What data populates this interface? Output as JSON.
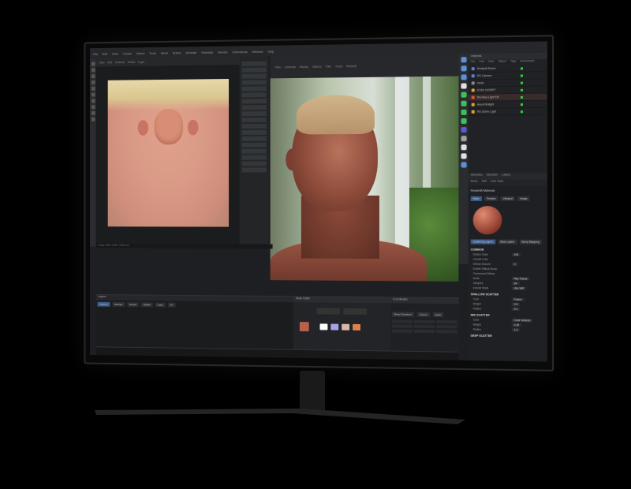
{
  "menubar": [
    "File",
    "Edit",
    "View",
    "Create",
    "Select",
    "Tools",
    "Mesh",
    "Spline",
    "Animate",
    "Simulate",
    "Render",
    "Extensions",
    "Window",
    "Help"
  ],
  "texture_panel": {
    "tabs": [
      "View",
      "Edit",
      "Channel",
      "Select",
      "Layer"
    ]
  },
  "viewport_toolbar": [
    "View",
    "Cameras",
    "Display",
    "Options",
    "Filter",
    "Panel",
    "Redshift"
  ],
  "objects": {
    "title": "Objects",
    "menu": [
      "File",
      "Edit",
      "View",
      "Object",
      "Tags",
      "Bookmarks"
    ],
    "rows": [
      {
        "label": "Redshift Dome",
        "color": "#5a7fd0",
        "selected": false
      },
      {
        "label": "RS Camera",
        "color": "#5a7fd0",
        "selected": false
      },
      {
        "label": "Head",
        "color": "#888888",
        "selected": false
      },
      {
        "label": "EYES SCRIPT",
        "color": "#e0a030",
        "selected": false
      },
      {
        "label": "RS Area Light Fill",
        "color": "#e05030",
        "selected": true
      },
      {
        "label": "Area Rimlight",
        "color": "#e0a030",
        "selected": false
      },
      {
        "label": "RS Dome Light",
        "color": "#e0a030",
        "selected": false
      }
    ]
  },
  "tool_icon_colors": [
    "#5d8fd8",
    "#5d8fd8",
    "#5d8fd8",
    "#e0e0e0",
    "#3dbf5a",
    "#3dbf5a",
    "#3dbf5a",
    "#3dbf5a",
    "#5a5ad8",
    "#a0a0a0",
    "#e0e0e0",
    "#e0e0e0",
    "#5d8fd8"
  ],
  "attributes": {
    "tabs": [
      "Attributes",
      "Structure",
      "Layers"
    ],
    "menu": [
      "Mode",
      "Edit",
      "User Data"
    ],
    "material_name": "Redshift Material",
    "subtabs": [
      {
        "label": "Basic",
        "active": true
      },
      {
        "label": "Preview",
        "active": false
      },
      {
        "label": "Viewport",
        "active": false
      },
      {
        "label": "Image",
        "active": false
      }
    ],
    "layers_tabs": [
      "Scattering Layers",
      "Base Layers",
      "Bump Mapping"
    ],
    "sections": [
      {
        "title": "COMMON",
        "props": [
          {
            "name": "Radius Scale",
            "value": "100"
          },
          {
            "name": "Overall Color",
            "value": ""
          },
          {
            "name": "Diffuse Amount",
            "value": "0"
          },
          {
            "name": "Enable Diffuse Bump",
            "value": ""
          },
          {
            "name": "Translucent Diffuse",
            "value": ""
          },
          {
            "name": "Mode",
            "value": "Ray Traced"
          },
          {
            "name": "Samples",
            "value": "64"
          },
          {
            "name": "Include Mode",
            "value": "Use Self"
          }
        ]
      },
      {
        "title": "SHALLOW SCATTER",
        "props": [
          {
            "name": "Color",
            "value": "Fusion"
          },
          {
            "name": "Weight",
            "value": "0.5"
          },
          {
            "name": "Radius",
            "value": "0.1"
          }
        ]
      },
      {
        "title": "MID SCATTER",
        "props": [
          {
            "name": "Color",
            "value": "Color General"
          },
          {
            "name": "Weight",
            "value": "0.25"
          },
          {
            "name": "Radius",
            "value": "1.0"
          }
        ]
      },
      {
        "title": "DEEP SCATTER",
        "props": []
      }
    ]
  },
  "bottom": {
    "status": "Image 2048 x 2048 - RGB 8 bit",
    "layers_title": "Layers",
    "layers_tabs": [
      {
        "label": "Material",
        "active": true
      },
      {
        "label": "Settings",
        "active": false
      },
      {
        "label": "Texture",
        "active": false
      },
      {
        "label": "Shader",
        "active": false
      },
      {
        "label": "Layer",
        "active": false
      },
      {
        "label": "UV",
        "active": false
      }
    ],
    "node_editor_title": "Node Editor",
    "coordinates_title": "Coordinates",
    "coordinates_buttons": [
      "Reset Transform",
      "Freeze",
      "Apply"
    ]
  }
}
